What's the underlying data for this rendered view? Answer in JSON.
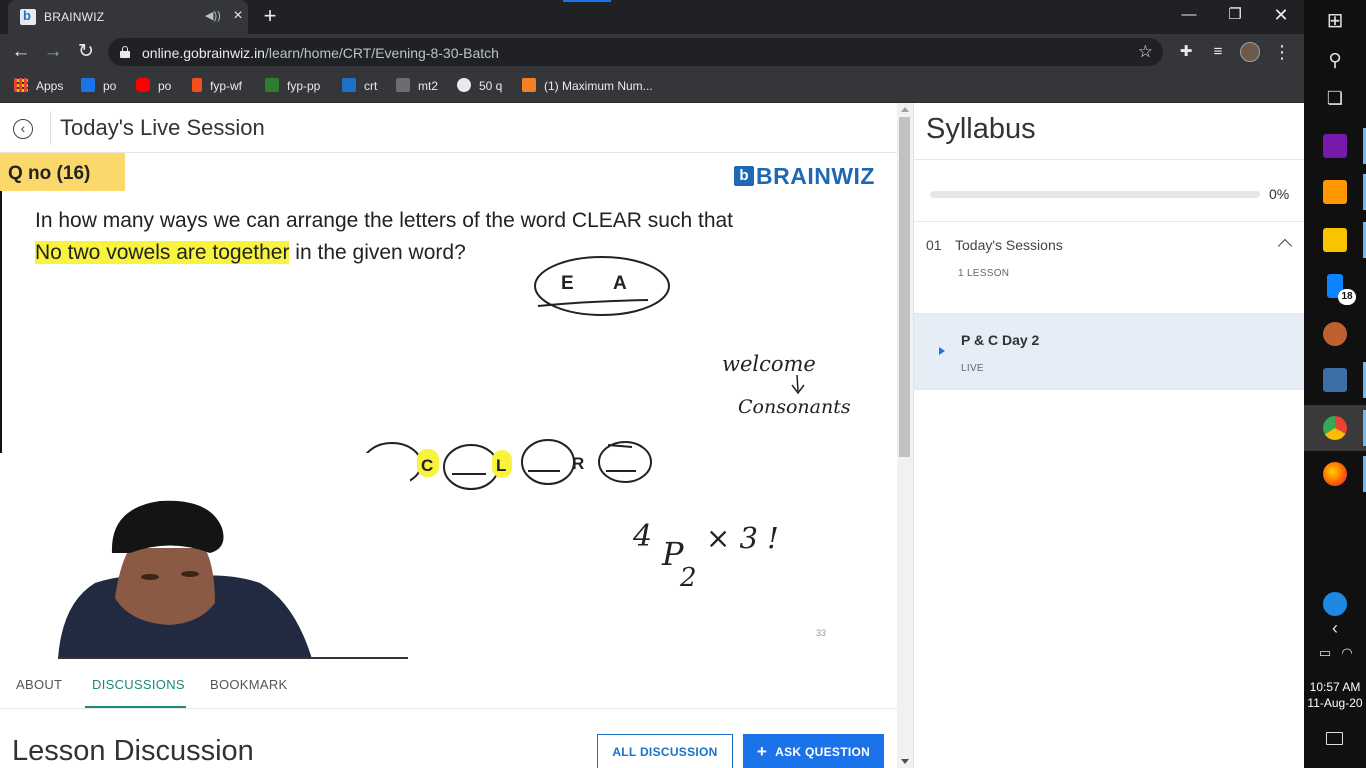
{
  "browser": {
    "tab_title": "BRAINWIZ",
    "url_host": "online.gobrainwiz.in",
    "url_path": "/learn/home/CRT/Evening-8-30-Batch",
    "bookmarks": [
      {
        "label": "Apps",
        "color": "#ea4335"
      },
      {
        "label": "po",
        "color": "#1a73e8"
      },
      {
        "label": "po",
        "color": "#ff0000"
      },
      {
        "label": "fyp-wf",
        "color": "#f24e1e"
      },
      {
        "label": "fyp-pp",
        "color": "#2e7d32"
      },
      {
        "label": "crt",
        "color": "#1a73c8"
      },
      {
        "label": "mt2",
        "color": "#6d6d6d"
      },
      {
        "label": "50 q",
        "color": "#e8eaed"
      },
      {
        "label": "(1) Maximum Num...",
        "color": "#f48024"
      }
    ]
  },
  "page": {
    "title": "Today's Live Session"
  },
  "video": {
    "question_no": "Q no (16)",
    "brand": "BRAINWIZ",
    "question_line1": "In how many ways we can arrange the letters of the word CLEAR such that",
    "question_highlight": "No two vowels are together",
    "question_line2_rest": " in the given word?",
    "vowel_e": "E",
    "vowel_a": "A",
    "cons_c": "C",
    "cons_l": "L",
    "cons_r": "R",
    "note_welcome": "welcome",
    "note_consonant": "Consonants",
    "formula_n": "4",
    "formula_p": "P",
    "formula_r": "2",
    "formula_rest": "× 3 !",
    "slide_number": "33"
  },
  "tabs": {
    "about": "ABOUT",
    "discussions": "DISCUSSIONS",
    "bookmark": "BOOKMARK"
  },
  "discussion": {
    "heading": "Lesson Discussion",
    "all_button": "ALL DISCUSSION",
    "ask_button": "ASK QUESTION"
  },
  "syllabus": {
    "title": "Syllabus",
    "progress_value": 0,
    "progress_label": "0%",
    "section_number": "01",
    "section_title": "Today's Sessions",
    "section_count": "1 LESSON",
    "lesson_title": "P & C Day 2",
    "lesson_status": "LIVE"
  },
  "taskbar": {
    "badge": "18",
    "time": "10:57 AM",
    "date": "11-Aug-20"
  }
}
